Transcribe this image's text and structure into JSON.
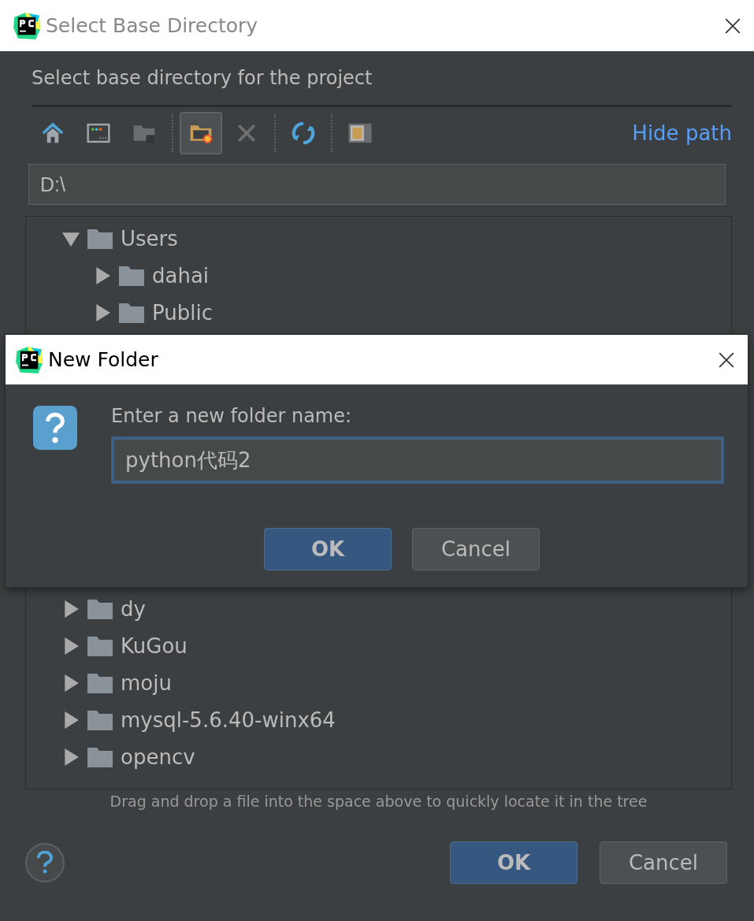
{
  "window": {
    "title": "Select Base Directory"
  },
  "description": "Select base directory for the project",
  "toolbar": [
    {
      "kind": "home",
      "selected": false,
      "disabled": false
    },
    {
      "kind": "desktop",
      "selected": false,
      "disabled": false
    },
    {
      "kind": "project",
      "selected": false,
      "disabled": true
    },
    {
      "kind": "new-folder",
      "selected": true,
      "disabled": false
    },
    {
      "kind": "delete",
      "selected": false,
      "disabled": true
    },
    {
      "kind": "refresh",
      "selected": false,
      "disabled": false
    },
    {
      "kind": "hidden",
      "selected": false,
      "disabled": false
    }
  ],
  "hide_path_link": "Hide path",
  "path_field": {
    "value": "D:\\"
  },
  "tree": [
    {
      "label": "Users",
      "expanded": true,
      "children": [
        {
          "label": "dahai",
          "expanded": false
        },
        {
          "label": "Public",
          "expanded": false
        }
      ]
    }
  ],
  "tree_below": [
    {
      "label": "dy",
      "expanded": false
    },
    {
      "label": "KuGou",
      "expanded": false
    },
    {
      "label": "moju",
      "expanded": false
    },
    {
      "label": "mysql-5.6.40-winx64",
      "expanded": false
    },
    {
      "label": "opencv",
      "expanded": false
    }
  ],
  "hint": "Drag and drop a file into the space above to quickly locate it in the tree",
  "buttons": [
    {
      "label": "OK",
      "default": true
    },
    {
      "label": "Cancel",
      "default": false
    }
  ],
  "new_folder_dialog": {
    "title": "New Folder",
    "prompt": "Enter a new folder name:",
    "field": {
      "value": "python代码2"
    },
    "buttons": [
      {
        "label": "OK",
        "default": true
      },
      {
        "label": "Cancel",
        "default": false
      }
    ]
  }
}
